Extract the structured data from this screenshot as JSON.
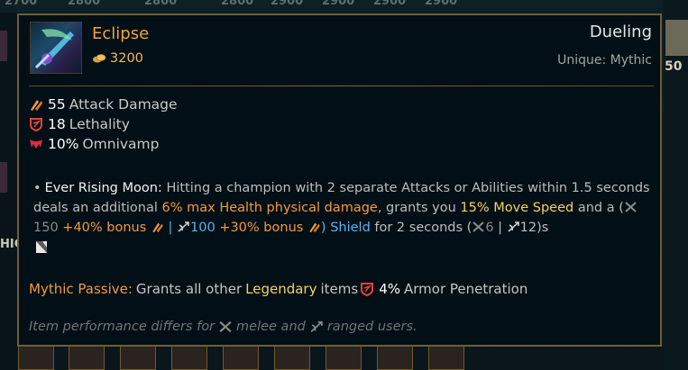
{
  "background": {
    "prices": [
      "2700",
      "2800",
      "2800",
      "2800",
      "2800",
      "2900",
      "2900",
      "2900",
      "2900"
    ],
    "section_label": "HIC",
    "right_number": "50"
  },
  "tooltip": {
    "title": "Eclipse",
    "price": "3200",
    "category": "Dueling",
    "unique": "Unique: Mythic",
    "stats": [
      {
        "icon": "attack-damage-icon",
        "value": "55",
        "label": "Attack Damage"
      },
      {
        "icon": "lethality-icon",
        "value": "18",
        "label": "Lethality"
      },
      {
        "icon": "omnivamp-icon",
        "value": "10%",
        "label": "Omnivamp"
      }
    ],
    "passive": {
      "name": "Ever Rising Moon:",
      "text1": "Hitting a champion with 2 separate Attacks or Abilities within 1.5 seconds deals an additional",
      "dmg": "6% max Health physical damage",
      "text2": ", grants you",
      "ms": "15% Move Speed",
      "text3": "and a (",
      "melee_val": "150",
      "melee_bonus": "+40% bonus",
      "sep1": "|",
      "ranged_val": "100",
      "ranged_bonus": "+30% bonus",
      "close_paren": ")",
      "shield": "Shield",
      "text4": "for 2 seconds (",
      "cd_melee": "6",
      "sep2": "|",
      "cd_ranged": "12)s"
    },
    "mythic": {
      "label": "Mythic Passive:",
      "text1": "Grants all other",
      "legendary": "Legendary",
      "text2": "items",
      "value": "4%",
      "text3": "Armor Penetration"
    },
    "note": {
      "text1": "Item performance differs for",
      "text2": "melee and",
      "text3": "ranged users."
    }
  },
  "colors": {
    "title": "#f0a53a",
    "gold": "#f0b957",
    "border": "#6d5d35",
    "orange": "#f39a3a",
    "yellow": "#f4d35e",
    "blue": "#4fb6f0"
  }
}
